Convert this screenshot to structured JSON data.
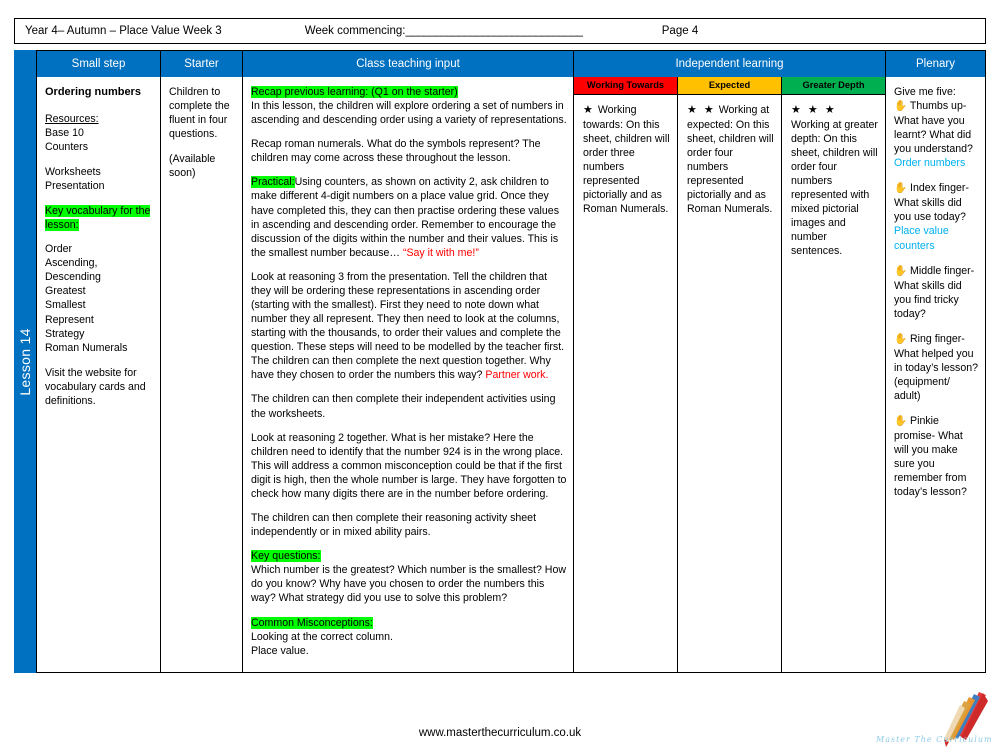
{
  "header": {
    "title": "Year 4– Autumn – Place Value Week 3",
    "week_commencing_label": "Week commencing:",
    "week_commencing_line": "______________________________",
    "page": "Page 4"
  },
  "spine": {
    "lesson_label": "Lesson 14",
    "color": "#0070c0"
  },
  "columns": {
    "small_step": "Small step",
    "starter": "Starter",
    "class_teaching_input": "Class teaching input",
    "independent_learning": "Independent learning",
    "plenary": "Plenary"
  },
  "small_step": {
    "title": "Ordering numbers",
    "resources_label": "Resources:",
    "resources": [
      "Base 10",
      "Counters"
    ],
    "materials": [
      "Worksheets",
      "Presentation"
    ],
    "vocab_heading": "Key vocabulary for the lesson:",
    "vocab": [
      "Order",
      "Ascending,",
      "Descending",
      "Greatest",
      "Smallest",
      "Represent",
      "Strategy",
      "Roman Numerals"
    ],
    "footer_note": "Visit the website for vocabulary cards and definitions."
  },
  "starter": {
    "paragraph": "Children to complete the fluent in four questions.",
    "availability": "(Available soon)"
  },
  "teaching": {
    "recap_heading": "Recap previous learning: (Q1 on the starter)",
    "recap_body": "In this lesson, the children will explore ordering a set of numbers in ascending and descending order using a variety of representations.",
    "roman_para": "Recap roman numerals. What do the symbols represent? The children may come across these throughout the lesson.",
    "practical_heading": "Practical:",
    "practical_body": "Using counters, as shown on activity 2, ask children to make different 4-digit numbers on a place value grid. Once they have completed this, they can then practise ordering these values in ascending and descending order. Remember to encourage the discussion of the digits within the number and their values. This is the smallest number because…",
    "practical_red": "“Say it with me!”",
    "reasoning3_body": "Look at reasoning 3 from the presentation. Tell the children that they will be ordering these representations in ascending order (starting with the smallest). First they need to note down what number they all represent. They then need to look at the columns, starting with the thousands, to order their values and complete the question. These steps will need to be modelled by the teacher first. The children can then complete the next question together. Why have they chosen to order the numbers this way?",
    "reasoning3_red": "Partner work.",
    "independent_para": "The children can then complete their independent activities using the worksheets.",
    "reasoning2_para": "Look at reasoning 2 together. What is her mistake? Here the children need to identify that the number 924 is in the wrong place. This will address a common misconception could be that if the first digit is high, then the whole number is large. They have forgotten to check how many digits there are in the number before ordering.",
    "reasoning_sheet_para": "The children can then complete their reasoning activity sheet independently or in mixed ability pairs.",
    "key_questions_heading": "Key questions:",
    "key_questions_body": "Which number is the greatest? Which number is the smallest? How do you know? Why have you chosen to order the numbers this way? What strategy did you use to solve this problem?",
    "misconceptions_heading": "Common Misconceptions:",
    "misconceptions_lines": [
      "Looking at the correct column.",
      "Place value."
    ]
  },
  "independent": {
    "levels": [
      {
        "label": "Working Towards",
        "color": "#FF0000",
        "stars": "★",
        "star_count": 1,
        "lead": "Working towards:",
        "body": "On this sheet, children will order three numbers represented pictorially and as Roman Numerals."
      },
      {
        "label": "Expected",
        "color": "#FFC000",
        "stars": "★ ★",
        "star_count": 2,
        "lead": "Working at expected:",
        "body": "On this sheet, children will order four numbers represented pictorially and as Roman Numerals."
      },
      {
        "label": "Greater Depth",
        "color": "#00B050",
        "stars": "★ ★ ★",
        "star_count": 3,
        "lead": "Working at greater depth:",
        "body": "On this sheet, children will order four numbers represented with mixed pictorial images and number sentences."
      }
    ]
  },
  "plenary": {
    "intro": "Give me five:",
    "items": [
      {
        "icon": "hand-icon",
        "glyph": "✋",
        "text": "Thumbs up- What have you learnt? What did you understand?",
        "answer": "Order numbers"
      },
      {
        "icon": "hand-icon",
        "glyph": "✋",
        "text": "Index finger- What skills did you use today?",
        "answer": "Place value counters"
      },
      {
        "icon": "hand-icon",
        "glyph": "✋",
        "text": "Middle finger- What skills did you find tricky today?",
        "answer": ""
      },
      {
        "icon": "hand-icon",
        "glyph": "✋",
        "text": "Ring finger- What helped you in today’s lesson? (equipment/ adult)",
        "answer": ""
      },
      {
        "icon": "hand-icon",
        "glyph": "✋",
        "text": "Pinkie promise- What will you make sure you remember from today’s lesson?",
        "answer": ""
      }
    ],
    "link_color": "#00B0F0"
  },
  "footer": {
    "url": "www.masterthecurriculum.co.uk",
    "logo_text": "Master  The  Curriculum"
  }
}
